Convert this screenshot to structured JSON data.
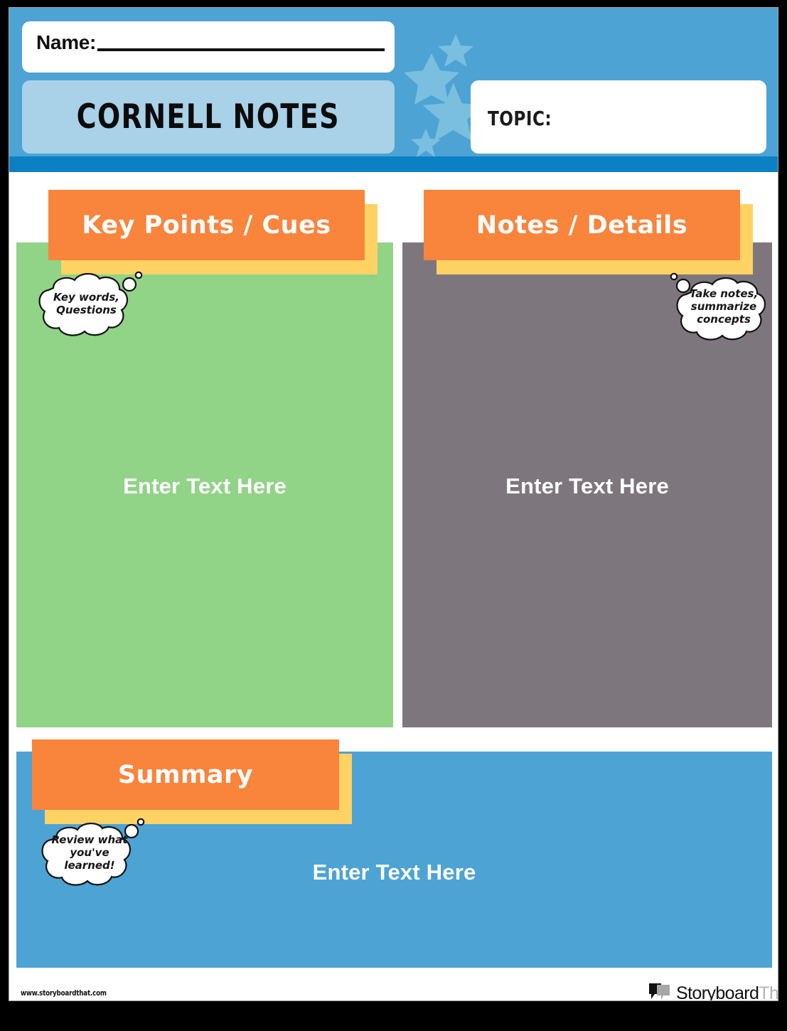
{
  "document": {
    "title": "CORNELL NOTES",
    "name_label": "Name:",
    "name_value": "",
    "topic_label": "TOPIC:",
    "topic_value": ""
  },
  "sections": {
    "cues": {
      "heading": "Key Points / Cues",
      "hint": "Key words,\nQuestions",
      "body_placeholder": "Enter Text Here"
    },
    "notes": {
      "heading": "Notes / Details",
      "hint": "Take notes,\nsummarize\nconcepts",
      "body_placeholder": "Enter Text Here"
    },
    "summary": {
      "heading": "Summary",
      "hint": "Review what\nyou've\nlearned!",
      "body_placeholder": "Enter Text Here"
    }
  },
  "footer": {
    "url": "www.storyboardthat.com",
    "logo_word_1": "Storyboard",
    "logo_word_2": "That",
    "logo_icon": "speech-bubbles-icon"
  },
  "colors": {
    "page_border": "#000000",
    "header_blue": "#4da3d4",
    "header_rule_blue": "#0b80c4",
    "title_pill_blue": "#a9d1e8",
    "star_blue": "#76bcdf",
    "cues_green": "#91d387",
    "notes_gray": "#7d777d",
    "summary_blue": "#4da3d4",
    "ribbon_orange": "#f9843c",
    "ribbon_shadow_yellow": "#ffd264",
    "text_white": "#ffffff",
    "text_black": "#111111"
  }
}
